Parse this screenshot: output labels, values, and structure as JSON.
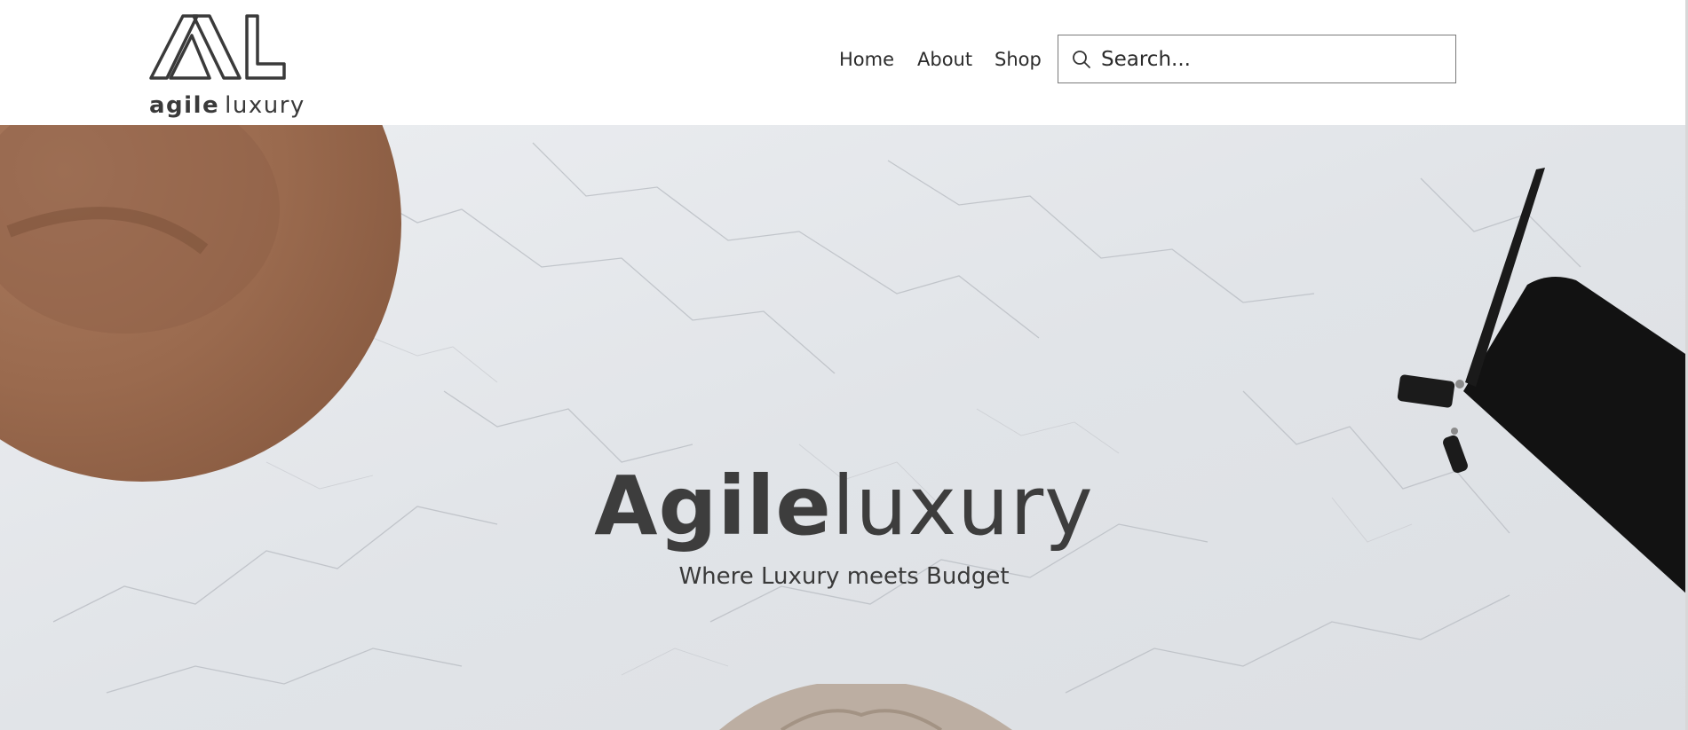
{
  "header": {
    "logo": {
      "text_bold": "agile",
      "text_light": "luxury",
      "mark_icon": "al-monogram-icon"
    },
    "nav": [
      {
        "label": "Home"
      },
      {
        "label": "About"
      },
      {
        "label": "Shop"
      }
    ],
    "search": {
      "placeholder": "Search...",
      "value": "",
      "icon": "search-icon"
    }
  },
  "hero": {
    "title_bold": "Agile",
    "title_light": "luxury",
    "subtitle": "Where Luxury meets Budget",
    "background": "marble-flatlay-image"
  },
  "colors": {
    "text_dark": "#3d3d3d",
    "search_border": "#7a7a7a",
    "hat_brown": "#9a6a4e",
    "clutch_black": "#121212",
    "sweater_beige": "#bcaea2"
  }
}
